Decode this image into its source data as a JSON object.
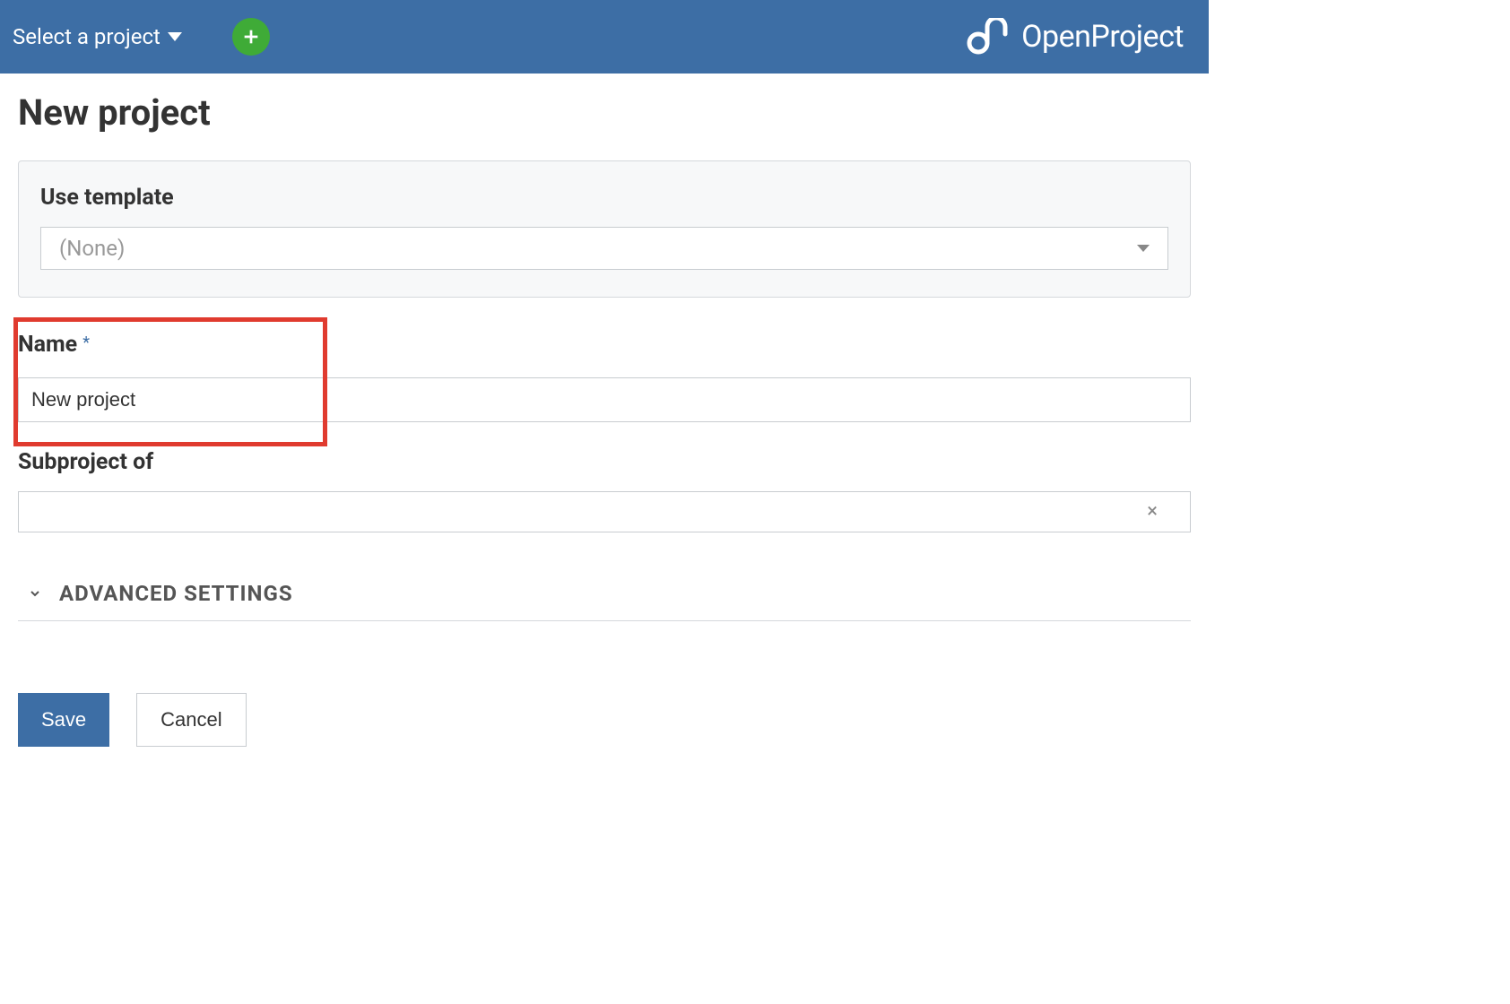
{
  "header": {
    "project_selector_label": "Select a project",
    "logo_text": "OpenProject"
  },
  "page": {
    "title": "New project"
  },
  "form": {
    "template": {
      "label": "Use template",
      "value": "(None)"
    },
    "name": {
      "label": "Name",
      "required_marker": "*",
      "value": "New project"
    },
    "subproject": {
      "label": "Subproject of",
      "value": ""
    },
    "advanced": {
      "label": "ADVANCED SETTINGS"
    },
    "buttons": {
      "save": "Save",
      "cancel": "Cancel"
    }
  }
}
